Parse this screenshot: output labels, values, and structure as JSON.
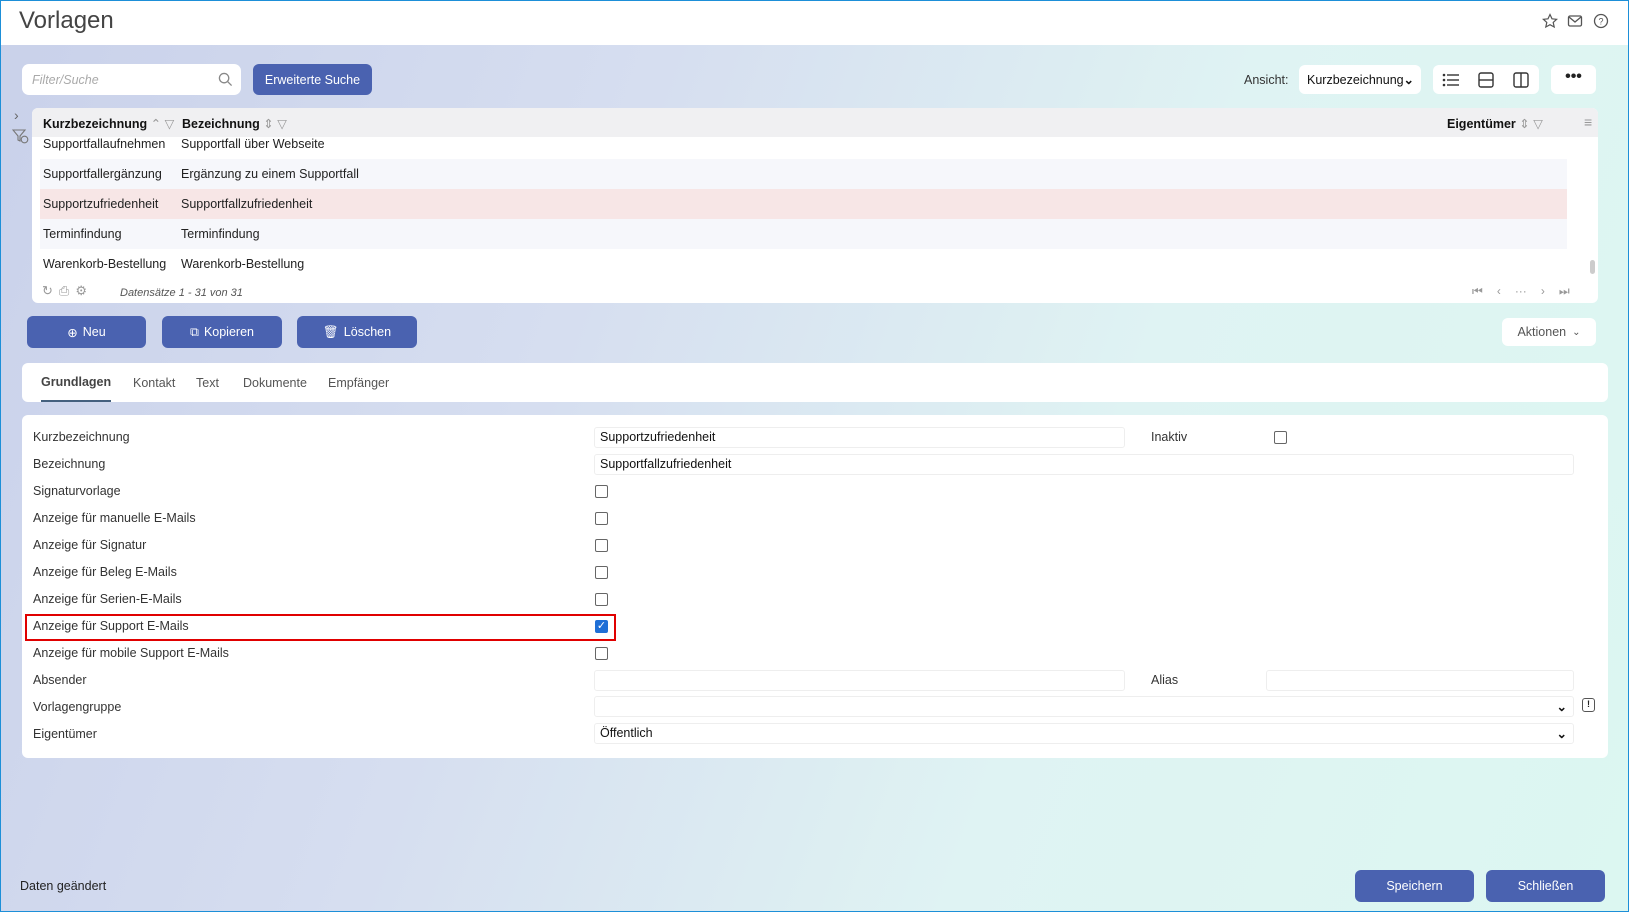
{
  "title": "Vorlagen",
  "search": {
    "placeholder": "Filter/Suche",
    "advanced": "Erweiterte Suche"
  },
  "view": {
    "label": "Ansicht:",
    "selected": "Kurzbezeichnung"
  },
  "grid": {
    "columns": [
      "Kurzbezeichnung",
      "Bezeichnung",
      "Eigentümer"
    ],
    "rows": [
      [
        "Supportfallaufnehmen",
        "Supportfall über Webseite"
      ],
      [
        "Supportfallergänzung",
        "Ergänzung zu einem Supportfall"
      ],
      [
        "Supportzufriedenheit",
        "Supportfallzufriedenheit"
      ],
      [
        "Terminfindung",
        "Terminfindung"
      ],
      [
        "Warenkorb-Bestellung",
        "Warenkorb-Bestellung"
      ]
    ],
    "records": "Datensätze 1 - 31 von 31",
    "pager_ellipsis": "···"
  },
  "actions": {
    "new": "Neu",
    "copy": "Kopieren",
    "delete": "Löschen",
    "more": "Aktionen"
  },
  "tabs": [
    "Grundlagen",
    "Kontakt",
    "Text",
    "Dokumente",
    "Empfänger"
  ],
  "form": {
    "labels": [
      "Kurzbezeichnung",
      "Bezeichnung",
      "Signaturvorlage",
      "Anzeige für manuelle E-Mails",
      "Anzeige für Signatur",
      "Anzeige für Beleg E-Mails",
      "Anzeige für Serien-E-Mails",
      "Anzeige für Support E-Mails",
      "Anzeige für mobile Support E-Mails",
      "Absender",
      "Vorlagengruppe",
      "Eigentümer"
    ],
    "kurzbezeichnung": "Supportzufriedenheit",
    "bezeichnung": "Supportfallzufriedenheit",
    "inaktiv_label": "Inaktiv",
    "alias_label": "Alias",
    "eigentuemer": "Öffentlich",
    "checks": {
      "signaturvorlage": false,
      "manuelle": false,
      "signatur": false,
      "beleg": false,
      "serien": false,
      "support": true,
      "mobile": false,
      "inaktiv": false
    }
  },
  "status": "Daten geändert",
  "footer": {
    "save": "Speichern",
    "close": "Schließen"
  },
  "colors": {
    "primary": "#4a62b0",
    "selected_row": "#f7e6e6",
    "highlight": "#e00000"
  }
}
